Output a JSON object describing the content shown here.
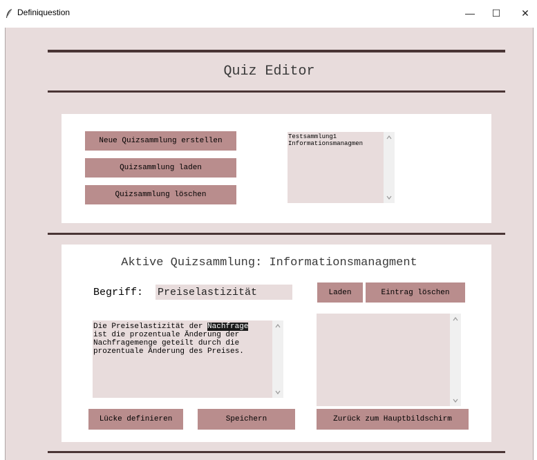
{
  "window": {
    "title": "Definiquestion",
    "minimize_glyph": "—",
    "maximize_glyph": "☐",
    "close_glyph": "✕"
  },
  "header": {
    "title": "Quiz Editor"
  },
  "collection_panel": {
    "new_button": "Neue Quizsammlung erstellen",
    "load_button": "Quizsammlung laden",
    "delete_button": "Quizsammlung löschen",
    "collections": [
      "Testsammlung1",
      "Informationsmanagmen"
    ]
  },
  "active_panel": {
    "title": "Aktive Quizsammlung: Informationsmanagment",
    "term_label": "Begriff:",
    "term_value": "Preiselastizität",
    "load_button": "Laden",
    "delete_entry_button": "Eintrag löschen",
    "definition_lines": {
      "line1_before": "Die Preiselastizität der ",
      "line1_selected": "Nachfrage",
      "line2": "ist die prozentuale Änderung der",
      "line3": "Nachfragemenge geteilt durch die",
      "line4": "prozentuale Änderung des Preises."
    },
    "define_gap_button": "Lücke definieren",
    "save_button": "Speichern",
    "back_button": "Zurück zum Hauptbildschirm"
  },
  "icons": {
    "app": "feather-icon",
    "scroll_up": "chevron-up-icon",
    "scroll_down": "chevron-down-icon"
  },
  "colors": {
    "background": "#e8dcdc",
    "button": "#b98d8d",
    "divider": "#4a3535",
    "panel": "#ffffff"
  }
}
